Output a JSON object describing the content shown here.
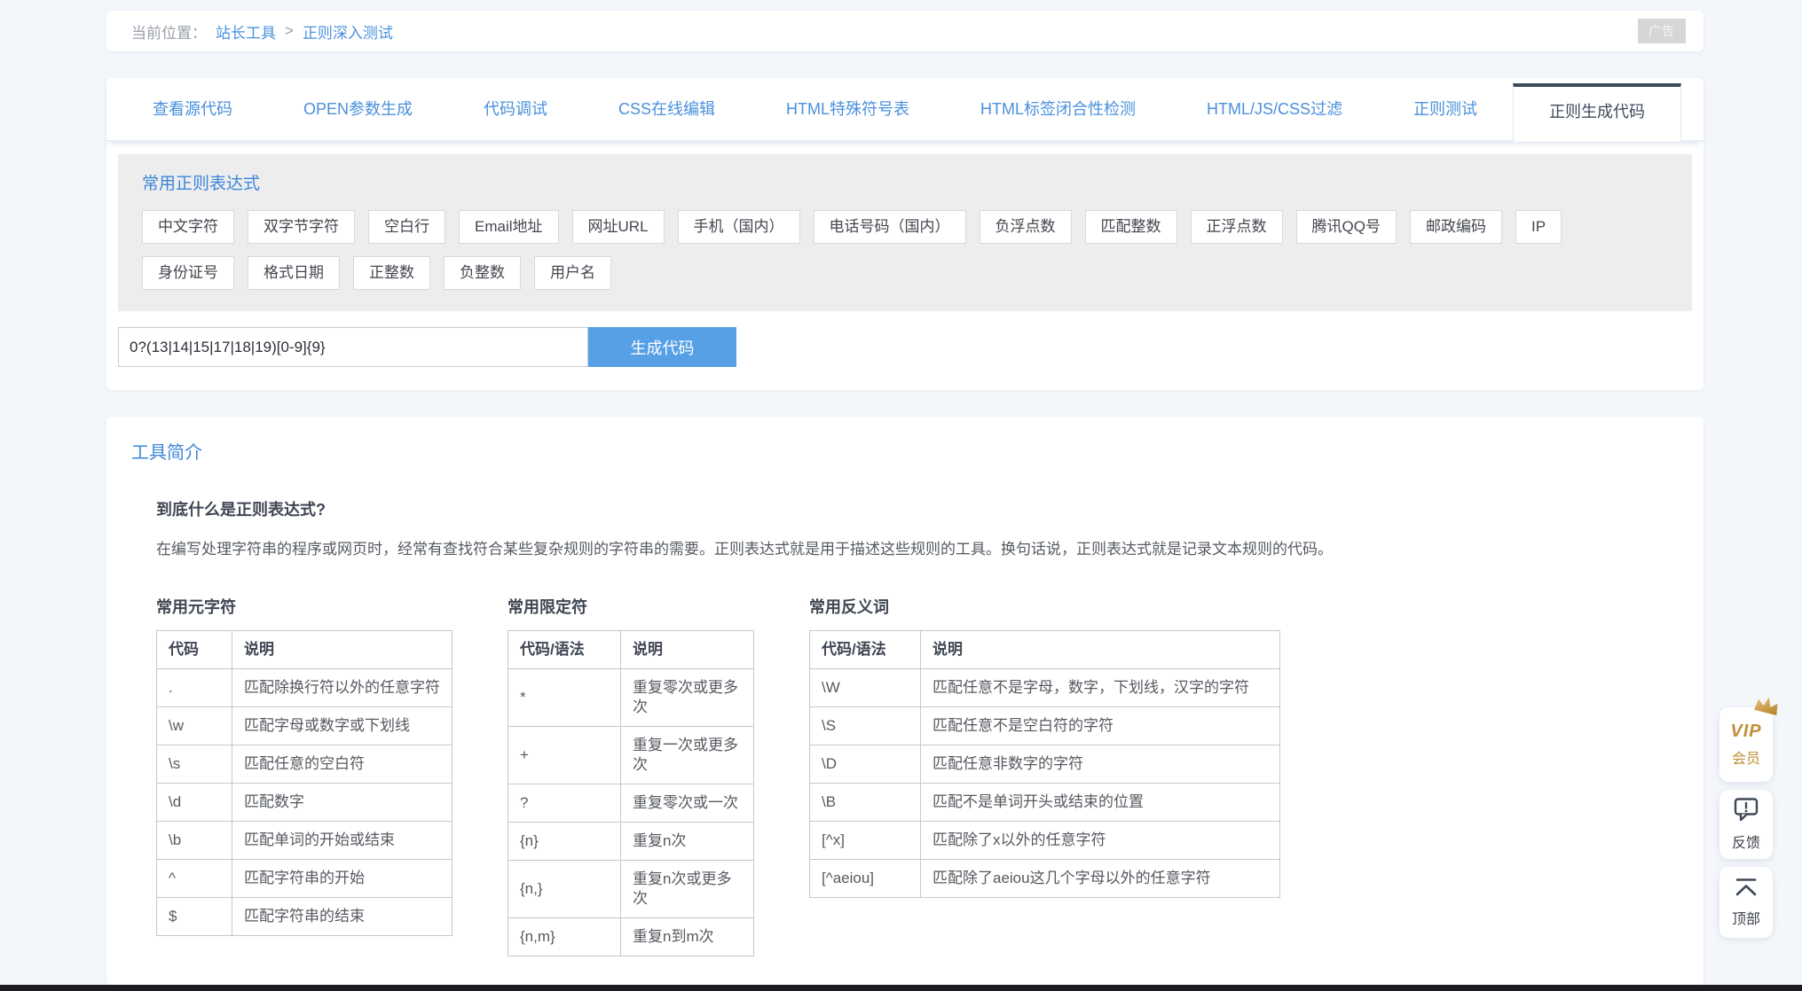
{
  "header": {
    "ad_label": "广告"
  },
  "breadcrumb": {
    "prefix": "当前位置：",
    "site": "站长工具",
    "sep": ">",
    "page": "正则深入测试"
  },
  "tabs": {
    "items": [
      {
        "label": "查看源代码",
        "active": false
      },
      {
        "label": "OPEN参数生成",
        "active": false
      },
      {
        "label": "代码调试",
        "active": false
      },
      {
        "label": "CSS在线编辑",
        "active": false
      },
      {
        "label": "HTML特殊符号表",
        "active": false
      },
      {
        "label": "HTML标签闭合性检测",
        "active": false
      },
      {
        "label": "HTML/JS/CSS过滤",
        "active": false
      },
      {
        "label": "正则测试",
        "active": false
      },
      {
        "label": "正则生成代码",
        "active": true
      }
    ]
  },
  "regex_panel": {
    "title": "常用正则表达式",
    "buttons": [
      "中文字符",
      "双字节字符",
      "空白行",
      "Email地址",
      "网址URL",
      "手机（国内）",
      "电话号码（国内）",
      "负浮点数",
      "匹配整数",
      "正浮点数",
      "腾讯QQ号",
      "邮政编码",
      "IP",
      "身份证号",
      "格式日期",
      "正整数",
      "负整数",
      "用户名"
    ],
    "input_value": "0?(13|14|15|17|18|19)[0-9]{9}",
    "generate_label": "生成代码"
  },
  "intro": {
    "title": "工具简介",
    "question_heading": "到底什么是正则表达式?",
    "paragraph": "在编写处理字符串的程序或网页时，经常有查找符合某些复杂规则的字符串的需要。正则表达式就是用于描述这些规则的工具。换句话说，正则表达式就是记录文本规则的代码。",
    "tables": [
      {
        "title": "常用元字符",
        "headers": [
          "代码",
          "说明"
        ],
        "rows": [
          [
            ".",
            "匹配除换行符以外的任意字符"
          ],
          [
            "\\w",
            "匹配字母或数字或下划线"
          ],
          [
            "\\s",
            "匹配任意的空白符"
          ],
          [
            "\\d",
            "匹配数字"
          ],
          [
            "\\b",
            "匹配单词的开始或结束"
          ],
          [
            "^",
            "匹配字符串的开始"
          ],
          [
            "$",
            "匹配字符串的结束"
          ]
        ]
      },
      {
        "title": "常用限定符",
        "headers": [
          "代码/语法",
          "说明"
        ],
        "rows": [
          [
            "*",
            "重复零次或更多次"
          ],
          [
            "+",
            "重复一次或更多次"
          ],
          [
            "?",
            "重复零次或一次"
          ],
          [
            "{n}",
            "重复n次"
          ],
          [
            "{n,}",
            "重复n次或更多次"
          ],
          [
            "{n,m}",
            "重复n到m次"
          ]
        ]
      },
      {
        "title": "常用反义词",
        "headers": [
          "代码/语法",
          "说明"
        ],
        "rows": [
          [
            "\\W",
            "匹配任意不是字母，数字，下划线，汉字的字符"
          ],
          [
            "\\S",
            "匹配任意不是空白符的字符"
          ],
          [
            "\\D",
            "匹配任意非数字的字符"
          ],
          [
            "\\B",
            "匹配不是单词开头或结束的位置"
          ],
          [
            "[^x]",
            "匹配除了x以外的任意字符"
          ],
          [
            "[^aeiou]",
            "匹配除了aeiou这几个字母以外的任意字符"
          ]
        ]
      }
    ]
  },
  "floating": {
    "vip_line1": "VIP",
    "vip_line2": "会员",
    "feedback_label": "反馈",
    "top_label": "顶部"
  },
  "colors": {
    "link_blue": "#4a90dc",
    "heading_blue": "#3d86d8",
    "button_blue": "#57a0e6",
    "active_tab_dark": "#3d4a5d",
    "vip_gold": "#c28e35"
  }
}
